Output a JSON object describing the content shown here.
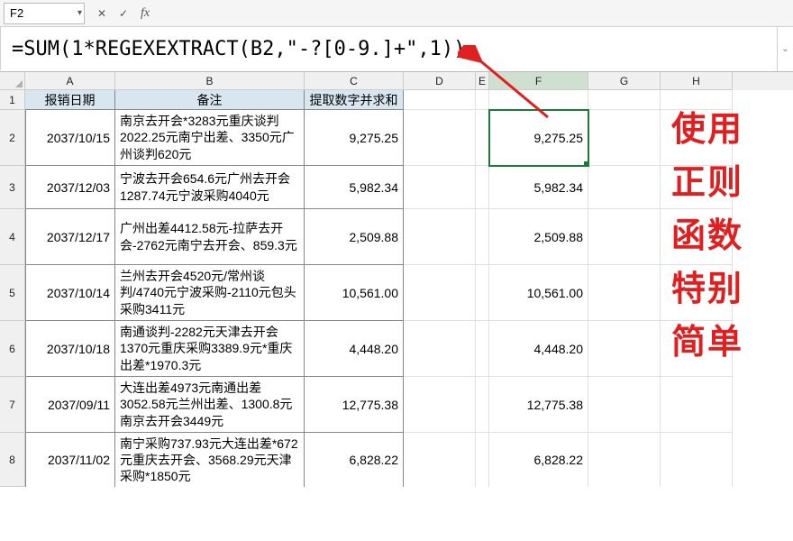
{
  "namebox": {
    "ref": "F2"
  },
  "formula": "=SUM(1*REGEXEXTRACT(B2,\"-?[0-9.]+\",1))",
  "cols": [
    "A",
    "B",
    "C",
    "D",
    "E",
    "F",
    "G",
    "H"
  ],
  "header": {
    "a": "报销日期",
    "b": "备注",
    "c": "提取数字并求和"
  },
  "rows": {
    "1": {
      "num": "1"
    },
    "2": {
      "num": "2",
      "a": "2037/10/15",
      "b": "南京去开会*3283元重庆谈判2022.25元南宁出差、3350元广州谈判620元",
      "c": "9,275.25",
      "f": "9,275.25"
    },
    "3": {
      "num": "3",
      "a": "2037/12/03",
      "b": "宁波去开会654.6元广州去开会1287.74元宁波采购4040元",
      "c": "5,982.34",
      "f": "5,982.34"
    },
    "4": {
      "num": "4",
      "a": "2037/12/17",
      "b": "广州出差4412.58元-拉萨去开会-2762元南宁去开会、859.3元",
      "c": "2,509.88",
      "f": "2,509.88"
    },
    "5": {
      "num": "5",
      "a": "2037/10/14",
      "b": "兰州去开会4520元/常州谈判/4740元宁波采购-2110元包头采购3411元",
      "c": "10,561.00",
      "f": "10,561.00"
    },
    "6": {
      "num": "6",
      "a": "2037/10/18",
      "b": "南通谈判-2282元天津去开会1370元重庆采购3389.9元*重庆出差*1970.3元",
      "c": "4,448.20",
      "f": "4,448.20"
    },
    "7": {
      "num": "7",
      "a": "2037/09/11",
      "b": "大连出差4973元南通出差3052.58元兰州出差、1300.8元南京去开会3449元",
      "c": "12,775.38",
      "f": "12,775.38"
    },
    "8": {
      "num": "8",
      "a": "2037/11/02",
      "b": "南宁采购737.93元大连出差*672元重庆去开会、3568.29元天津采购*1850元",
      "c": "6,828.22",
      "f": "6,828.22"
    }
  },
  "annotation": {
    "line1": "使用",
    "line2": "正则",
    "line3": "函数",
    "line4": "特别",
    "line5": "简单"
  }
}
